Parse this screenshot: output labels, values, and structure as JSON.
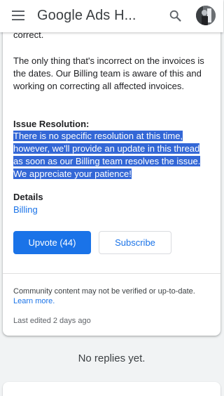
{
  "appbar": {
    "title": "Google Ads H...",
    "menu_icon": "menu-icon",
    "search_icon": "search-icon",
    "avatar_icon": "avatar"
  },
  "post": {
    "text_top": "correct.",
    "paragraph1": "The only thing that's incorrect on the invoices is the dates. Our Billing team is aware of this and working on correcting all affected invoices.",
    "issue_label": "Issue Resolution:",
    "resolution_text": "There is no specific resolution at this time, however, we'll provide an update in this thread as soon as our Billing team resolves the issue. We appreciate your patience!",
    "details_label": "Details",
    "details_value": "Billing",
    "upvote_label": "Upvote (44)",
    "subscribe_label": "Subscribe",
    "notice_text": "Community content may not be verified or up-to-date.",
    "learn_more": "Learn more.",
    "last_edited": "Last edited 2 days ago"
  },
  "replies": {
    "empty_text": "No replies yet."
  },
  "colors": {
    "accent": "#1a73e8",
    "selection": "#3367d6"
  }
}
